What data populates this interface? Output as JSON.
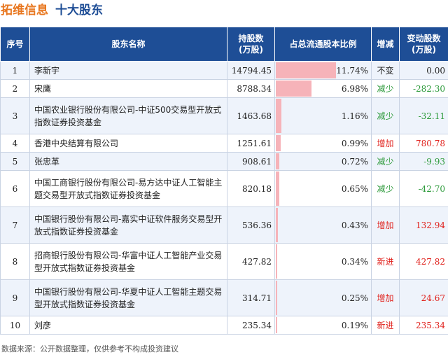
{
  "header": {
    "company": "拓维信息",
    "subtitle": "十大股东"
  },
  "columns": {
    "index": "序号",
    "name": "股东名称",
    "shares_line1": "持股数",
    "shares_line2": "(万股)",
    "ratio": "占总流通股本比例",
    "change": "增减",
    "delta_line1": "变动股数",
    "delta_line2": "(万股)"
  },
  "rows": [
    {
      "index": "1",
      "name": "李新宇",
      "shares": "14794.45",
      "ratio": "11.74%",
      "ratio_value": 11.74,
      "change": "不变",
      "change_type": "same",
      "delta": "0.00"
    },
    {
      "index": "2",
      "name": "宋鹰",
      "shares": "8788.34",
      "ratio": "6.98%",
      "ratio_value": 6.98,
      "change": "减少",
      "change_type": "down",
      "delta": "-282.30"
    },
    {
      "index": "3",
      "name": "中国农业银行股份有限公司-中证500交易型开放式指数证券投资基金",
      "shares": "1463.68",
      "ratio": "1.16%",
      "ratio_value": 1.16,
      "change": "减少",
      "change_type": "down",
      "delta": "-32.11"
    },
    {
      "index": "4",
      "name": "香港中央结算有限公司",
      "shares": "1251.61",
      "ratio": "0.99%",
      "ratio_value": 0.99,
      "change": "增加",
      "change_type": "up",
      "delta": "780.78"
    },
    {
      "index": "5",
      "name": "张忠革",
      "shares": "908.61",
      "ratio": "0.72%",
      "ratio_value": 0.72,
      "change": "减少",
      "change_type": "down",
      "delta": "-9.93"
    },
    {
      "index": "6",
      "name": "中国工商银行股份有限公司-易方达中证人工智能主题交易型开放式指数证券投资基金",
      "shares": "820.18",
      "ratio": "0.65%",
      "ratio_value": 0.65,
      "change": "减少",
      "change_type": "down",
      "delta": "-42.70"
    },
    {
      "index": "7",
      "name": "中国银行股份有限公司-嘉实中证软件服务交易型开放式指数证券投资基金",
      "shares": "536.36",
      "ratio": "0.43%",
      "ratio_value": 0.43,
      "change": "增加",
      "change_type": "up",
      "delta": "132.94"
    },
    {
      "index": "8",
      "name": "招商银行股份有限公司-华富中证人工智能产业交易型开放式指数证券投资基金",
      "shares": "427.82",
      "ratio": "0.34%",
      "ratio_value": 0.34,
      "change": "新进",
      "change_type": "up",
      "delta": "427.82"
    },
    {
      "index": "9",
      "name": "中国银行股份有限公司-华夏中证人工智能主题交易型开放式指数证券投资基金",
      "shares": "314.71",
      "ratio": "0.25%",
      "ratio_value": 0.25,
      "change": "增加",
      "change_type": "up",
      "delta": "24.67"
    },
    {
      "index": "10",
      "name": "刘彦",
      "shares": "235.34",
      "ratio": "0.19%",
      "ratio_value": 0.19,
      "change": "新进",
      "change_type": "up",
      "delta": "235.34"
    }
  ],
  "footer": {
    "source": "数据来源：公开数据整理，仅供参考不构成投资建议"
  },
  "colors": {
    "header_bg": "#1e4e96",
    "company": "#e8761e",
    "subtitle": "#1f4e96",
    "bar": "#f6b3b9",
    "up": "#e0201b",
    "down": "#2c9a3a"
  }
}
